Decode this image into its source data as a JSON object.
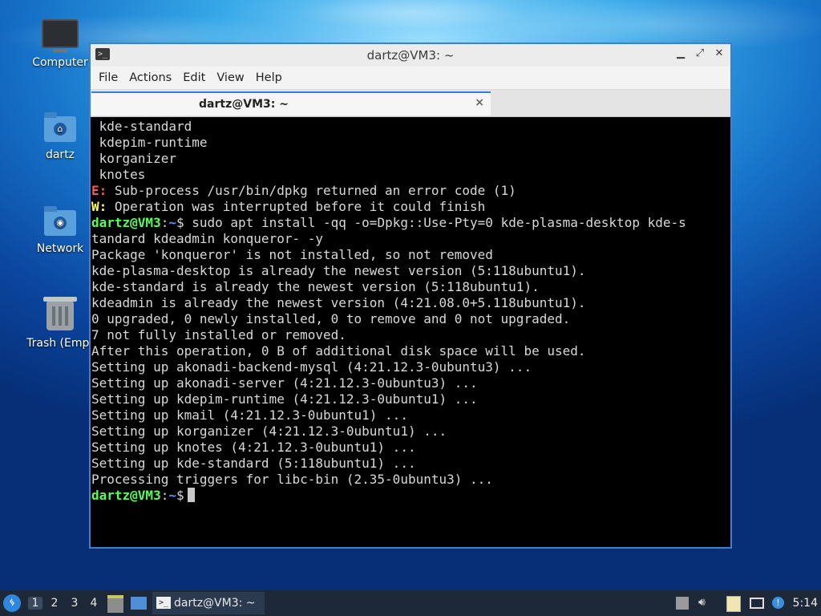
{
  "desktop": {
    "icons": [
      {
        "label": "Computer",
        "icon": "computer-icon"
      },
      {
        "label": "dartz",
        "icon": "home-folder-icon"
      },
      {
        "label": "Network",
        "icon": "network-folder-icon"
      },
      {
        "label": "Trash (Empt",
        "icon": "trash-icon"
      }
    ]
  },
  "window": {
    "title": "dartz@VM3: ~",
    "app_icon": "terminal-icon",
    "menu": [
      "File",
      "Actions",
      "Edit",
      "View",
      "Help"
    ],
    "tab": {
      "title": "dartz@VM3: ~",
      "close_glyph": "×"
    },
    "controls": {
      "minimize": "▁",
      "maximize": "⤢",
      "close": "✕"
    }
  },
  "terminal": {
    "colors": {
      "error": "#ff5555",
      "warning": "#ffff55",
      "user": "#55ff55",
      "path": "#6e8cff",
      "text": "#d8d8d8",
      "background": "#000000"
    },
    "lines": [
      {
        "segments": [
          {
            "text": " kde-standard"
          }
        ]
      },
      {
        "segments": [
          {
            "text": " kdepim-runtime"
          }
        ]
      },
      {
        "segments": [
          {
            "text": " korganizer"
          }
        ]
      },
      {
        "segments": [
          {
            "text": " knotes"
          }
        ]
      },
      {
        "segments": [
          {
            "text": "E:",
            "cls": "red"
          },
          {
            "text": " Sub-process /usr/bin/dpkg returned an error code (1)"
          }
        ]
      },
      {
        "segments": [
          {
            "text": "W:",
            "cls": "yel"
          },
          {
            "text": " Operation was interrupted before it could finish"
          }
        ]
      },
      {
        "segments": [
          {
            "text": "dartz@VM3",
            "cls": "grn"
          },
          {
            "text": ":"
          },
          {
            "text": "~",
            "cls": "blu"
          },
          {
            "text": "$ sudo apt install -qq -o=Dpkg::Use-Pty=0 kde-plasma-desktop kde-s"
          }
        ]
      },
      {
        "segments": [
          {
            "text": "tandard kdeadmin konqueror- -y"
          }
        ]
      },
      {
        "segments": [
          {
            "text": "Package 'konqueror' is not installed, so not removed"
          }
        ]
      },
      {
        "segments": [
          {
            "text": "kde-plasma-desktop is already the newest version (5:118ubuntu1)."
          }
        ]
      },
      {
        "segments": [
          {
            "text": "kde-standard is already the newest version (5:118ubuntu1)."
          }
        ]
      },
      {
        "segments": [
          {
            "text": "kdeadmin is already the newest version (4:21.08.0+5.118ubuntu1)."
          }
        ]
      },
      {
        "segments": [
          {
            "text": "0 upgraded, 0 newly installed, 0 to remove and 0 not upgraded."
          }
        ]
      },
      {
        "segments": [
          {
            "text": "7 not fully installed or removed."
          }
        ]
      },
      {
        "segments": [
          {
            "text": "After this operation, 0 B of additional disk space will be used."
          }
        ]
      },
      {
        "segments": [
          {
            "text": "Setting up akonadi-backend-mysql (4:21.12.3-0ubuntu3) ..."
          }
        ]
      },
      {
        "segments": [
          {
            "text": "Setting up akonadi-server (4:21.12.3-0ubuntu3) ..."
          }
        ]
      },
      {
        "segments": [
          {
            "text": "Setting up kdepim-runtime (4:21.12.3-0ubuntu1) ..."
          }
        ]
      },
      {
        "segments": [
          {
            "text": "Setting up kmail (4:21.12.3-0ubuntu1) ..."
          }
        ]
      },
      {
        "segments": [
          {
            "text": "Setting up korganizer (4:21.12.3-0ubuntu1) ..."
          }
        ]
      },
      {
        "segments": [
          {
            "text": "Setting up knotes (4:21.12.3-0ubuntu1) ..."
          }
        ]
      },
      {
        "segments": [
          {
            "text": "Setting up kde-standard (5:118ubuntu1) ..."
          }
        ]
      },
      {
        "segments": [
          {
            "text": "Processing triggers for libc-bin (2.35-0ubuntu3) ..."
          }
        ]
      },
      {
        "segments": [
          {
            "text": "dartz@VM3",
            "cls": "grn"
          },
          {
            "text": ":"
          },
          {
            "text": "~",
            "cls": "blu"
          },
          {
            "text": "$"
          }
        ],
        "cursor": true
      }
    ]
  },
  "taskbar": {
    "start_icon": "lubuntu-start-icon",
    "workspaces": [
      "1",
      "2",
      "3",
      "4"
    ],
    "active_workspace": "1",
    "task": {
      "label": "dartz@VM3: ~",
      "icon": "terminal-icon"
    },
    "tray_icons": [
      "eject-icon",
      "volume-icon",
      "clipboard-icon",
      "network-icon",
      "update-notifier-icon"
    ],
    "clock": "5:14"
  }
}
